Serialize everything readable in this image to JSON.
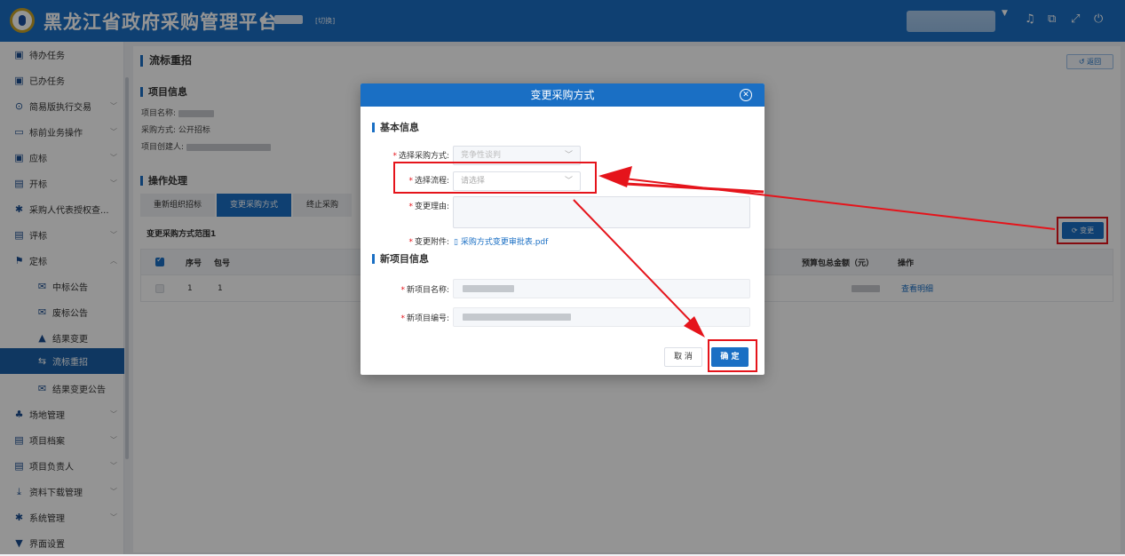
{
  "app": {
    "title": "黑龙江省政府采购管理平台",
    "switch_label": "[切换]",
    "icons": [
      "bell-icon",
      "layout-icon",
      "fullscreen-icon",
      "power-icon"
    ]
  },
  "sidebar": {
    "items": [
      {
        "label": "待办任务",
        "icon": "todo-icon",
        "chevron": false
      },
      {
        "label": "已办任务",
        "icon": "done-icon",
        "chevron": false
      },
      {
        "label": "简易版执行交易",
        "icon": "play-icon",
        "chevron": true
      },
      {
        "label": "标前业务操作",
        "icon": "cart-icon",
        "chevron": true
      },
      {
        "label": "应标",
        "icon": "bid-icon",
        "chevron": true
      },
      {
        "label": "开标",
        "icon": "open-bid-icon",
        "chevron": true
      },
      {
        "label": "采购人代表授权查...",
        "icon": "gear-icon",
        "chevron": false
      },
      {
        "label": "评标",
        "icon": "evaluate-icon",
        "chevron": true
      },
      {
        "label": "定标",
        "icon": "decide-icon",
        "chevron": true
      },
      {
        "label": "中标公告",
        "icon": "mail-icon",
        "sub": true
      },
      {
        "label": "废标公告",
        "icon": "mail-icon",
        "sub": true
      },
      {
        "label": "结果变更",
        "icon": "lock-icon",
        "sub": true
      },
      {
        "label": "流标重招",
        "icon": "retender-icon",
        "sub": true,
        "active": true
      },
      {
        "label": "结果变更公告",
        "icon": "mail-icon",
        "sub": true
      },
      {
        "label": "场地管理",
        "icon": "venue-icon",
        "chevron": true
      },
      {
        "label": "项目档案",
        "icon": "archive-icon",
        "chevron": true
      },
      {
        "label": "项目负责人",
        "icon": "person-icon",
        "chevron": true
      },
      {
        "label": "资料下载管理",
        "icon": "download-icon",
        "chevron": true
      },
      {
        "label": "系统管理",
        "icon": "gear-icon",
        "chevron": true
      },
      {
        "label": "界面设置",
        "icon": "shirt-icon",
        "chevron": false
      }
    ]
  },
  "main": {
    "title": "流标重招",
    "back_label": "返回",
    "project_info": {
      "heading": "项目信息",
      "name_label": "项目名称:",
      "method_label": "采购方式:",
      "method_value": "公开招标",
      "creator_label": "项目创建人:"
    },
    "operations": {
      "heading": "操作处理",
      "tabs": [
        "重新组织招标",
        "变更采购方式",
        "终止采购"
      ],
      "active_tab": 1
    },
    "range_label": "变更采购方式范围1",
    "change_label": "变更",
    "table": {
      "headers": [
        "序号",
        "包号",
        "预算包总金额（元）",
        "操作"
      ],
      "rows": [
        {
          "index": "1",
          "package": "1",
          "action": "查看明细"
        }
      ]
    }
  },
  "dialog": {
    "title": "变更采购方式",
    "basic_heading": "基本信息",
    "method_label": "选择采购方式:",
    "method_value": "竞争性谈判",
    "flow_label": "选择流程:",
    "flow_placeholder": "请选择",
    "reason_label": "变更理由:",
    "attachment_label": "变更附件:",
    "attachment_file": "采购方式变更审批表.pdf",
    "new_heading": "新项目信息",
    "new_name_label": "新项目名称:",
    "new_code_label": "新项目编号:",
    "cancel_label": "取 消",
    "ok_label": "确 定"
  },
  "colors": {
    "primary": "#1a6fc4",
    "annotation_red": "#e5141b",
    "sidebar_active": "#1a5fa8"
  }
}
